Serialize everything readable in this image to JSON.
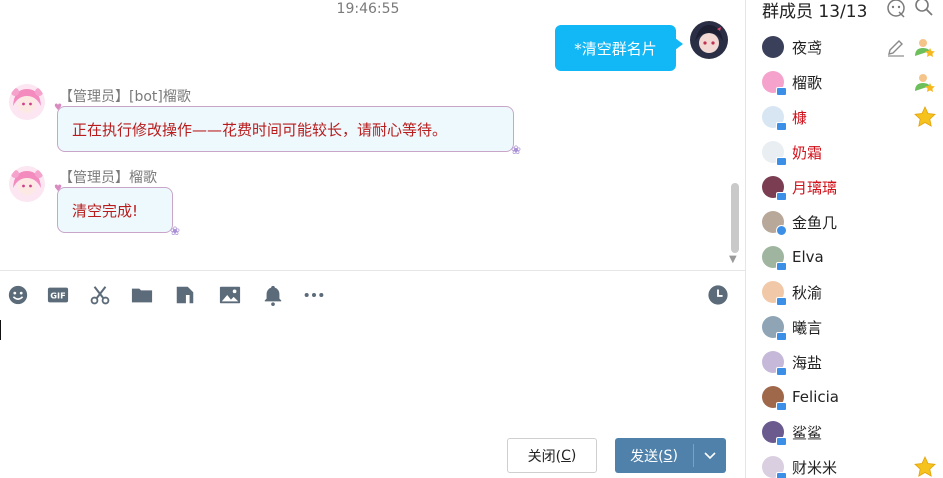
{
  "chat": {
    "timestamp": "19:46:55",
    "my_message": "*清空群名片",
    "messages": [
      {
        "sender": "【管理员】[bot]榴歌",
        "text": "正在执行修改操作——花费时间可能较长，请耐心等待。"
      },
      {
        "sender": "【管理员】榴歌",
        "text": "清空完成!"
      }
    ]
  },
  "toolbar": {
    "icons": [
      "emoji-icon",
      "gif-icon",
      "scissors-icon",
      "folder-icon",
      "doc-icon",
      "image-icon",
      "bell-icon",
      "more-icon",
      "history-clock-icon"
    ],
    "gif_label": "GIF"
  },
  "input": {
    "value": ""
  },
  "buttons": {
    "close_label": "关闭(",
    "close_key": "C",
    "close_end": ")",
    "send_label": "发送(",
    "send_key": "S",
    "send_end": ")"
  },
  "members": {
    "title": "群成员 13/13",
    "list": [
      {
        "name": "夜鸢",
        "role": "owner",
        "color": "normal"
      },
      {
        "name": "榴歌",
        "role": "admin",
        "color": "normal"
      },
      {
        "name": "槺",
        "role": "star",
        "color": "red"
      },
      {
        "name": "奶霜",
        "role": "",
        "color": "red"
      },
      {
        "name": "月璃璃",
        "role": "",
        "color": "red"
      },
      {
        "name": "金鱼几",
        "role": "",
        "color": "normal"
      },
      {
        "name": "Elva",
        "role": "",
        "color": "normal"
      },
      {
        "name": "秋渝",
        "role": "",
        "color": "normal"
      },
      {
        "name": "曦言",
        "role": "",
        "color": "normal"
      },
      {
        "name": "海盐",
        "role": "",
        "color": "normal"
      },
      {
        "name": "Felicia",
        "role": "",
        "color": "normal"
      },
      {
        "name": "鲨鲨",
        "role": "",
        "color": "normal"
      },
      {
        "name": "财米米",
        "role": "star",
        "color": "normal"
      }
    ]
  },
  "colors": {
    "accent": "#12b7f5",
    "send_button": "#4f81aa",
    "red_name": "#d0121b",
    "bot_text": "#b81c1c"
  }
}
